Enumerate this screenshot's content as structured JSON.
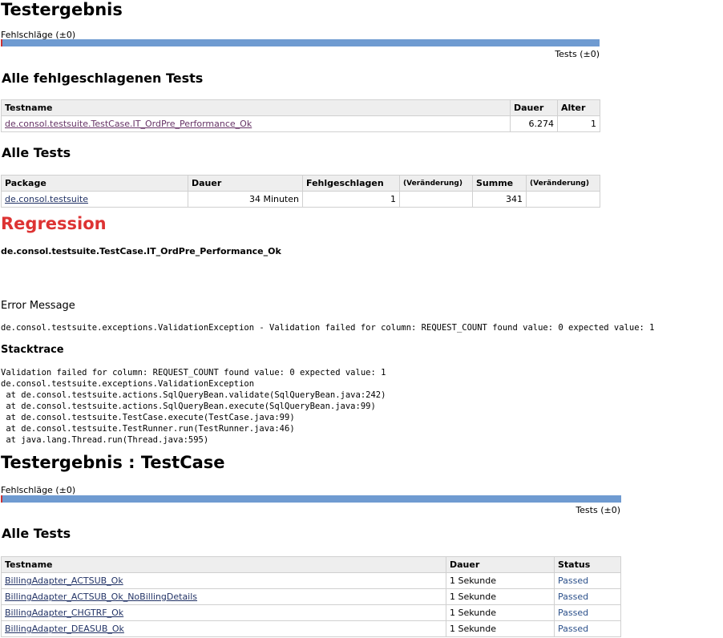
{
  "summary": {
    "title": "Testergebnis",
    "failures_label": "Fehlschläge (±0)",
    "tests_label": "Tests (±0)"
  },
  "failed_tests": {
    "heading": "Alle fehlgeschlagenen Tests",
    "headers": [
      "Testname",
      "Dauer",
      "Alter"
    ],
    "rows": [
      {
        "name": "de.consol.testsuite.TestCase.IT_OrdPre_Performance_Ok",
        "duration": "6.274",
        "age": "1"
      }
    ]
  },
  "all_tests": {
    "heading": "Alle Tests",
    "headers": [
      "Package",
      "Dauer",
      "Fehlgeschlagen",
      "(Veränderung)",
      "Summe",
      "(Veränderung)"
    ],
    "rows": [
      {
        "package": "de.consol.testsuite",
        "duration": "34 Minuten",
        "failed": "1",
        "failed_change": "",
        "total": "341",
        "total_change": ""
      }
    ]
  },
  "regression": {
    "heading": "Regression",
    "test_name": "de.consol.testsuite.TestCase.IT_OrdPre_Performance_Ok",
    "error_message_label": "Error Message",
    "error_message": "de.consol.testsuite.exceptions.ValidationException - Validation failed for column: REQUEST_COUNT found value: 0 expected value: 1",
    "stacktrace_label": "Stacktrace",
    "stacktrace": "Validation failed for column: REQUEST_COUNT found value: 0 expected value: 1\nde.consol.testsuite.exceptions.ValidationException\n at de.consol.testsuite.actions.SqlQueryBean.validate(SqlQueryBean.java:242)\n at de.consol.testsuite.actions.SqlQueryBean.execute(SqlQueryBean.java:99)\n at de.consol.testsuite.TestCase.execute(TestCase.java:99)\n at de.consol.testsuite.TestRunner.run(TestRunner.java:46)\n at java.lang.Thread.run(Thread.java:595)"
  },
  "testcase": {
    "title": "Testergebnis : TestCase",
    "failures_label": "Fehlschläge (±0)",
    "tests_label": "Tests (±0)",
    "heading": "Alle Tests",
    "headers": [
      "Testname",
      "Dauer",
      "Status"
    ],
    "rows": [
      {
        "name": "BillingAdapter_ACTSUB_Ok",
        "duration": "1 Sekunde",
        "status": "Passed"
      },
      {
        "name": "BillingAdapter_ACTSUB_Ok_NoBillingDetails",
        "duration": "1 Sekunde",
        "status": "Passed"
      },
      {
        "name": "BillingAdapter_CHGTRF_Ok",
        "duration": "1 Sekunde",
        "status": "Passed"
      },
      {
        "name": "BillingAdapter_DEASUB_Ok",
        "duration": "1 Sekunde",
        "status": "Passed"
      }
    ]
  },
  "colors": {
    "bar_pass": "#6f9bd1",
    "bar_fail": "#cc3333",
    "regression": "#dd3333",
    "link": "#223366",
    "link_visited": "#663366",
    "passed": "#2a4f8a"
  },
  "progress": {
    "summary_failed_fraction": 0.003,
    "testcase_failed_fraction": 0.0
  }
}
